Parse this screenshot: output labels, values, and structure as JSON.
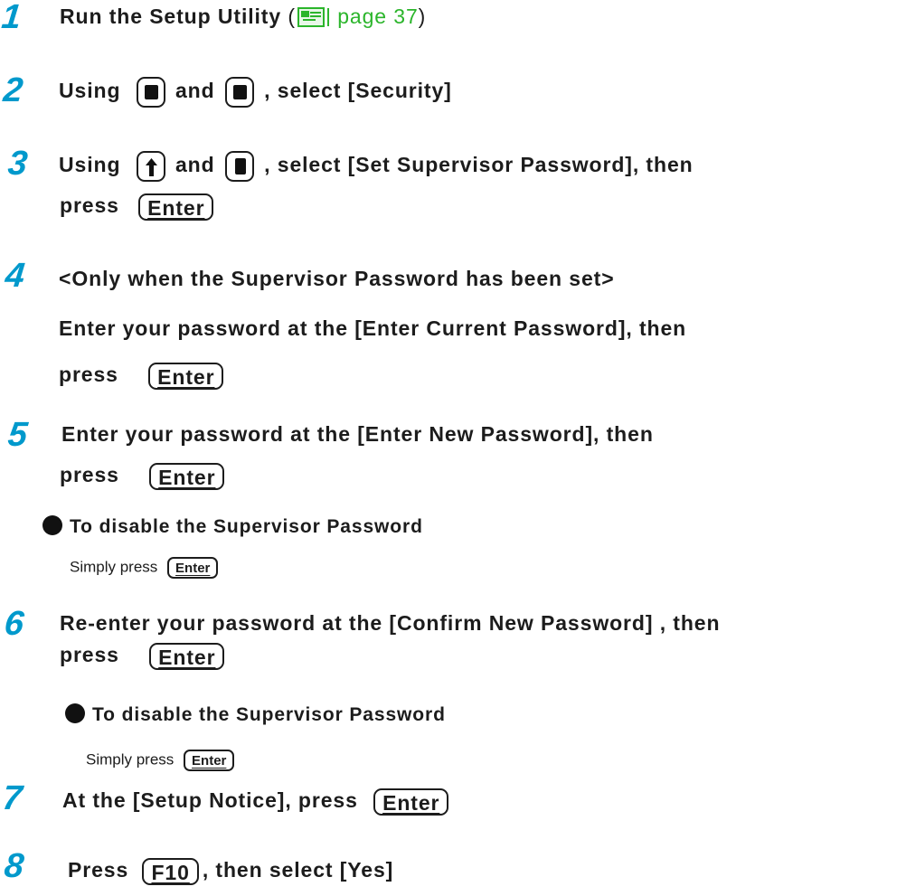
{
  "steps": [
    {
      "number": "1",
      "text": "Run the Setup Utility",
      "ref_open": "(",
      "ref_page": "page 37",
      "ref_close": ")"
    },
    {
      "number": "2",
      "prefix": "Using",
      "mid": "and",
      "suffix": ", select [Security]"
    },
    {
      "number": "3",
      "prefix": "Using",
      "mid": "and",
      "suffix": ", select [Set Supervisor Password], then",
      "line2": "press",
      "key": "Enter"
    },
    {
      "number": "4",
      "line1": "<Only when the Supervisor Password has been set>",
      "line2": "Enter your password at the [Enter Current Password], then",
      "line3": "press",
      "key": "Enter"
    },
    {
      "number": "5",
      "line1": "Enter your password at the [Enter New Password], then",
      "line2": "press",
      "key": "Enter",
      "sub_heading": "To disable the Supervisor Password",
      "sub_text": "Simply press",
      "sub_key": "Enter"
    },
    {
      "number": "6",
      "line1": "Re-enter your password at the [Confirm New Password] , then",
      "line2": "press",
      "key": "Enter",
      "sub_heading": "To disable the Supervisor Password",
      "sub_text": "Simply press",
      "sub_key": "Enter"
    },
    {
      "number": "7",
      "text": "At the [Setup Notice], press",
      "key": "Enter"
    },
    {
      "number": "8",
      "prefix": "Press",
      "key": "F10",
      "suffix": ", then select [Yes]"
    }
  ],
  "icons": {
    "reference": "page-reference-icon",
    "left_arrow": "left-arrow-key-icon",
    "right_arrow": "right-arrow-key-icon",
    "up_arrow": "up-arrow-key-icon",
    "down_arrow": "down-arrow-key-icon",
    "bullet": "bullet-icon"
  },
  "colors": {
    "step_number": "#0099cc",
    "link": "#2bb52b",
    "text": "#1c1c1c"
  }
}
